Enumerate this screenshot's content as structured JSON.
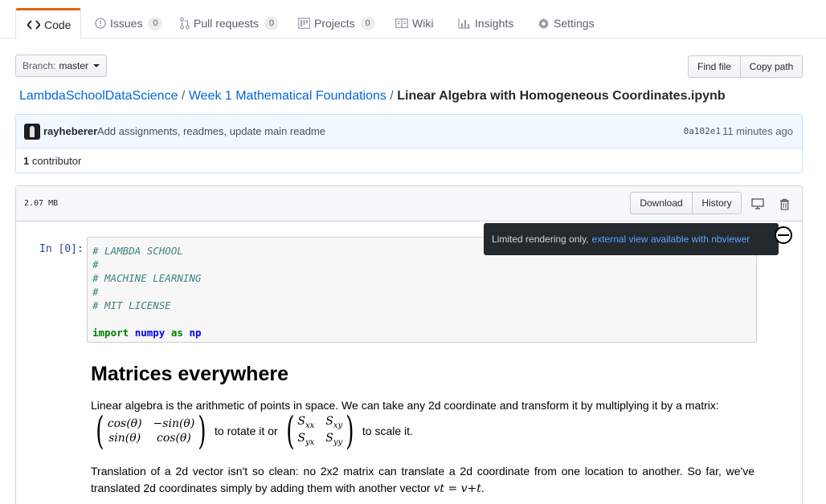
{
  "tabs": [
    {
      "label": "Code",
      "icon": "code-icon",
      "count": null,
      "selected": true
    },
    {
      "label": "Issues",
      "icon": "issue-icon",
      "count": "0"
    },
    {
      "label": "Pull requests",
      "icon": "pull-request-icon",
      "count": "0"
    },
    {
      "label": "Projects",
      "icon": "project-icon",
      "count": "0"
    },
    {
      "label": "Wiki",
      "icon": "book-icon",
      "count": null
    },
    {
      "label": "Insights",
      "icon": "graph-icon",
      "count": null
    },
    {
      "label": "Settings",
      "icon": "gear-icon",
      "count": null
    }
  ],
  "branch": {
    "label": "Branch:",
    "name": "master"
  },
  "file_actions": {
    "find_file": "Find file",
    "copy_path": "Copy path"
  },
  "breadcrumb": {
    "repo": "LambdaSchoolDataScience",
    "folder": "Week 1 Mathematical Foundations",
    "file": "Linear Algebra with Homogeneous Coordinates.ipynb",
    "separator": "/"
  },
  "commit": {
    "author": "rayheberer",
    "message": "Add assignments, readmes, update main readme",
    "sha": "0a102e1",
    "time": "11 minutes ago",
    "contributors_count": "1",
    "contributors_label": "contributor"
  },
  "file": {
    "size": "2.07 MB",
    "download": "Download",
    "history": "History"
  },
  "tooltip": {
    "text": "Limited rendering only,",
    "link": "external view available with nbviewer"
  },
  "notebook": {
    "prompt": "In [0]:",
    "code_lines": [
      {
        "parts": [
          {
            "t": "# LAMBDA SCHOOL",
            "c": "cm"
          }
        ]
      },
      {
        "parts": [
          {
            "t": "#",
            "c": "cm"
          }
        ]
      },
      {
        "parts": [
          {
            "t": "# MACHINE LEARNING",
            "c": "cm"
          }
        ]
      },
      {
        "parts": [
          {
            "t": "#",
            "c": "cm"
          }
        ]
      },
      {
        "parts": [
          {
            "t": "# MIT LICENSE",
            "c": "cm"
          }
        ]
      },
      {
        "parts": []
      },
      {
        "parts": [
          {
            "t": "import",
            "c": "kw"
          },
          {
            "t": " ",
            "c": ""
          },
          {
            "t": "numpy",
            "c": "nn"
          },
          {
            "t": " ",
            "c": ""
          },
          {
            "t": "as",
            "c": "kw"
          },
          {
            "t": " ",
            "c": ""
          },
          {
            "t": "np",
            "c": "nn"
          }
        ]
      }
    ],
    "heading": "Matrices everywhere",
    "para1": "Linear algebra is the arithmetic of points in space. We can take any 2d coordinate and transform it by multiplying it by a matrix:",
    "rotation_matrix": [
      "cos(θ)",
      "−sin(θ)",
      "sin(θ)",
      "cos(θ)"
    ],
    "rotate_text": "to rotate it or",
    "scale_matrix": [
      "Sxx",
      "Sxy",
      "Syx",
      "Syy"
    ],
    "scale_text": "to scale it.",
    "para2_a": "Translation of a 2d vector isn't so clean: no 2x2 matrix can translate a 2d coordinate from one location to another. So far, we've translated 2d coordinates simply by adding them with another vector",
    "para2_math": "vt = v+t",
    "para2_end": "."
  }
}
